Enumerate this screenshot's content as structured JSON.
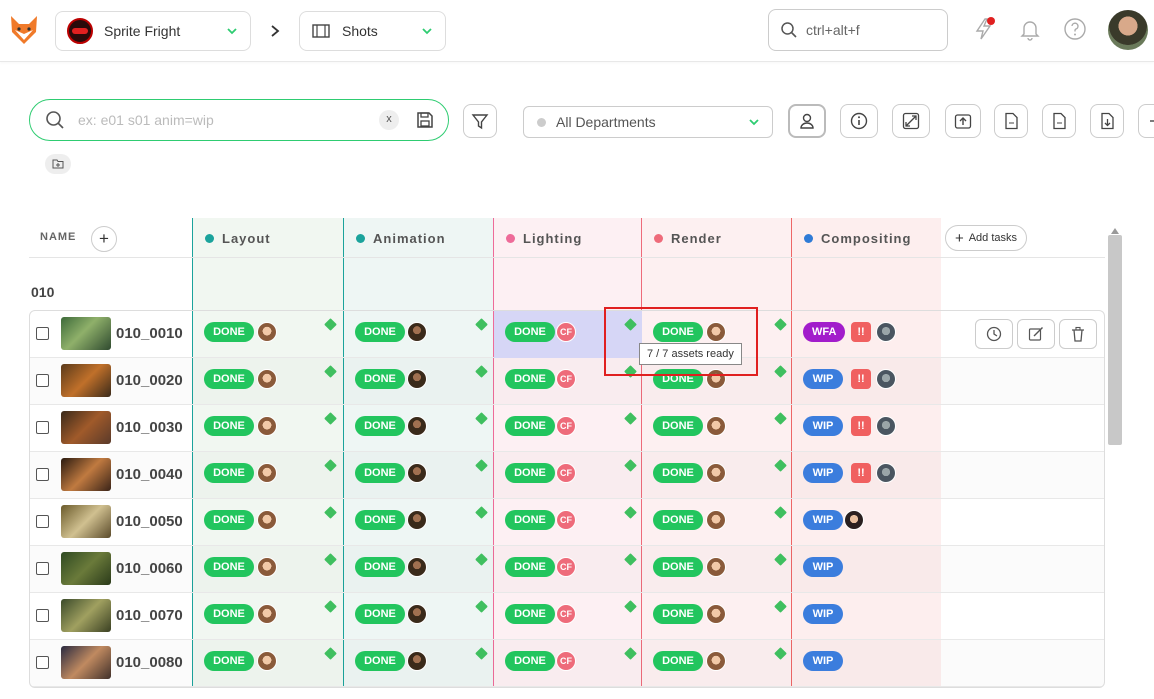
{
  "topbar": {
    "production": "Sprite Fright",
    "section": "Shots",
    "global_search": "ctrl+alt+f"
  },
  "filters": {
    "search_placeholder": "ex: e01 s01 anim=wip",
    "clear_label": "x",
    "department": "All Departments"
  },
  "table": {
    "name_header": "NAME",
    "add_column": "+",
    "add_tasks": "Add tasks",
    "columns": [
      {
        "label": "Layout",
        "color": "#1ba39c"
      },
      {
        "label": "Animation",
        "color": "#1ba39c"
      },
      {
        "label": "Lighting",
        "color": "#ee6b99"
      },
      {
        "label": "Render",
        "color": "#ee6b7a"
      },
      {
        "label": "Compositing",
        "color": "#2f7bd6"
      }
    ],
    "group": "010",
    "rows": [
      {
        "name": "010_0010",
        "comp_status": "WFA",
        "comp_priority": "!!",
        "comp_person": "comp"
      },
      {
        "name": "010_0020",
        "comp_status": "WIP",
        "comp_priority": "!!",
        "comp_person": "comp"
      },
      {
        "name": "010_0030",
        "comp_status": "WIP",
        "comp_priority": "!!",
        "comp_person": "comp"
      },
      {
        "name": "010_0040",
        "comp_status": "WIP",
        "comp_priority": "!!",
        "comp_person": "comp"
      },
      {
        "name": "010_0050",
        "comp_status": "WIP",
        "comp_priority": "",
        "comp_person": "woman"
      },
      {
        "name": "010_0060",
        "comp_status": "WIP",
        "comp_priority": "",
        "comp_person": ""
      },
      {
        "name": "010_0070",
        "comp_status": "WIP",
        "comp_priority": "",
        "comp_person": ""
      },
      {
        "name": "010_0080",
        "comp_status": "WIP",
        "comp_priority": "",
        "comp_person": ""
      }
    ],
    "done_label": "DONE",
    "lighting_assignee": "CF"
  },
  "tooltip": "7 / 7 assets ready"
}
